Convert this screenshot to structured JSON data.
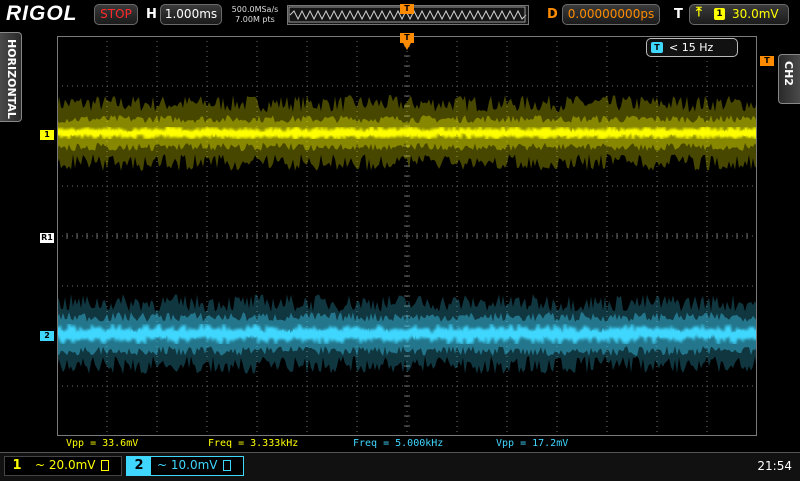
{
  "brand": "RIGOL",
  "run_state": "STOP",
  "horizontal": {
    "label": "H",
    "timebase": "1.000ms",
    "sample_rate": "500.0MSa/s",
    "mem_depth": "7.00M pts"
  },
  "delay": {
    "label": "D",
    "value": "0.00000000ps"
  },
  "trigger": {
    "label": "T",
    "channel_badge": "1",
    "level": "30.0mV",
    "marker_label": "T"
  },
  "side_tabs": {
    "left": "HORIZONTAL",
    "right": "CH2"
  },
  "filter_readout": "< 15 Hz",
  "channel_markers": {
    "ch1": "1",
    "ch2": "2",
    "ref": "R1"
  },
  "measurements": [
    {
      "text": "Vpp = 33.6mV",
      "color": "#ffff00"
    },
    {
      "text": "Freq = 3.333kHz",
      "color": "#ffff00"
    },
    {
      "text": "Freq = 5.000kHz",
      "color": "#40d7ff"
    },
    {
      "text": "Vpp = 17.2mV",
      "color": "#40d7ff"
    }
  ],
  "channels": [
    {
      "number": "1",
      "coupling_scale": "~ 20.0mV",
      "color": "#ffff00",
      "active": false
    },
    {
      "number": "2",
      "coupling_scale": "~ 10.0mV",
      "color": "#40d7ff",
      "active": true
    }
  ],
  "clock": "21:54",
  "colors": {
    "ch1": "#ffff00",
    "ch2": "#40d7ff",
    "trigger": "#ff8c00",
    "grid": "#6b6b6b"
  }
}
